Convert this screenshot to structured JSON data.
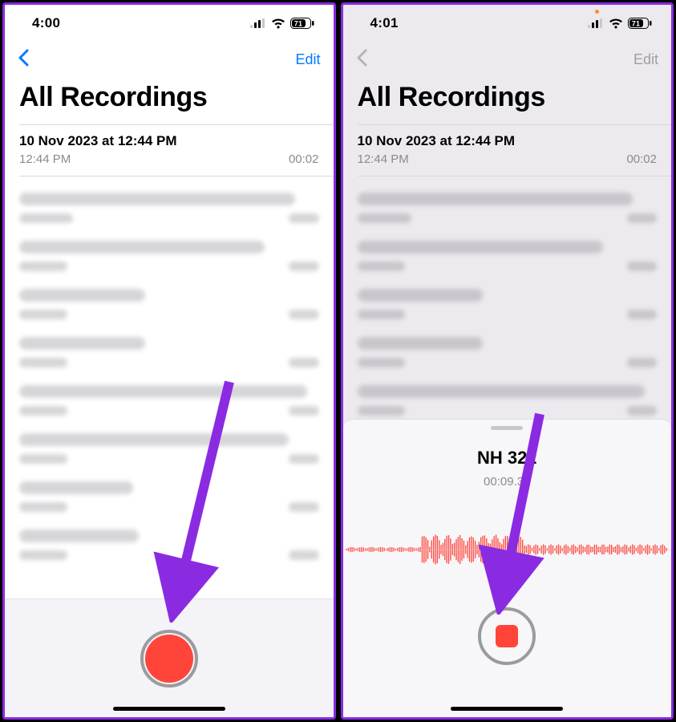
{
  "left": {
    "status": {
      "time": "4:00",
      "battery": "71"
    },
    "nav": {
      "edit": "Edit"
    },
    "title": "All Recordings",
    "rec": {
      "title": "10 Nov 2023 at 12:44 PM",
      "time": "12:44 PM",
      "dur": "00:02"
    },
    "placeholders": [
      {
        "w1": 92,
        "w2a": 18,
        "w2b": 10
      },
      {
        "w1": 82,
        "w2a": 16,
        "w2b": 10
      },
      {
        "w1": 42,
        "w2a": 16,
        "w2b": 10
      },
      {
        "w1": 42,
        "w2a": 16,
        "w2b": 10
      },
      {
        "w1": 96,
        "w2a": 16,
        "w2b": 10
      },
      {
        "w1": 90,
        "w2a": 16,
        "w2b": 10
      },
      {
        "w1": 38,
        "w2a": 16,
        "w2b": 10
      },
      {
        "w1": 40,
        "w2a": 16,
        "w2b": 10
      }
    ]
  },
  "right": {
    "status": {
      "time": "4:01",
      "battery": "71"
    },
    "nav": {
      "edit": "Edit"
    },
    "title": "All Recordings",
    "rec": {
      "title": "10 Nov 2023 at 12:44 PM",
      "time": "12:44 PM",
      "dur": "00:02"
    },
    "placeholders": [
      {
        "w1": 92,
        "w2a": 18,
        "w2b": 10
      },
      {
        "w1": 82,
        "w2a": 16,
        "w2b": 10
      },
      {
        "w1": 42,
        "w2a": 16,
        "w2b": 10
      },
      {
        "w1": 42,
        "w2a": 16,
        "w2b": 10
      },
      {
        "w1": 96,
        "w2a": 16,
        "w2b": 10
      }
    ],
    "sheet": {
      "title": "NH 322",
      "timer": "00:09.32"
    }
  },
  "colors": {
    "accent": "#007aff",
    "record": "#ff453a",
    "arrow": "#8a2be2"
  }
}
